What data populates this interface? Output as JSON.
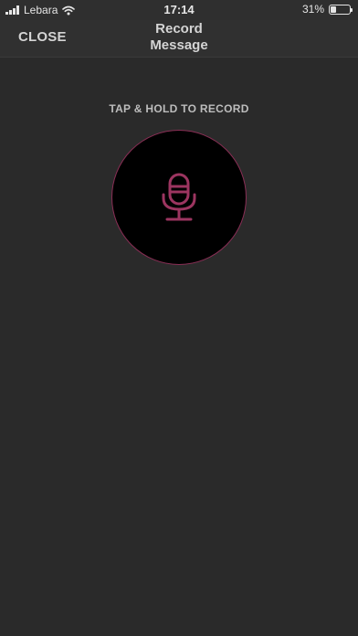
{
  "status_bar": {
    "carrier": "Lebara",
    "time": "17:14",
    "battery_percent_label": "31%",
    "battery_level": 0.31
  },
  "nav": {
    "close_label": "CLOSE",
    "title_line1": "Record",
    "title_line2": "Message"
  },
  "recorder": {
    "instruction": "TAP & HOLD TO RECORD",
    "icon": "microphone-icon",
    "accent_color": "#9c3560"
  }
}
